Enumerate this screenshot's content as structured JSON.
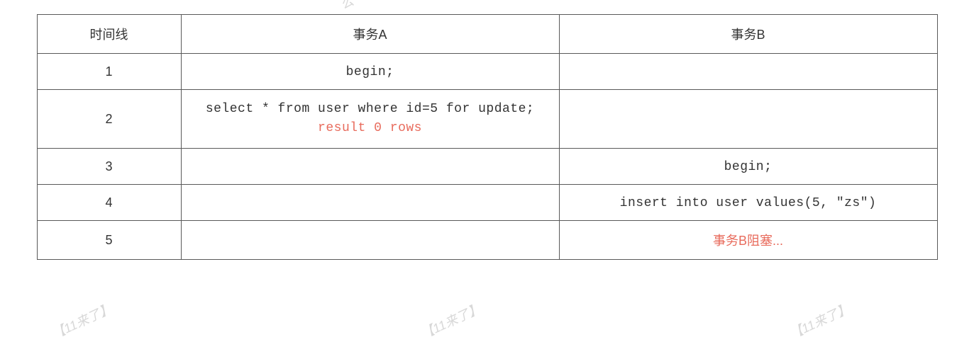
{
  "watermarks": [
    "公",
    "【11来了】",
    "【11来了】",
    "【11来了】"
  ],
  "table": {
    "headers": [
      "时间线",
      "事务A",
      "事务B"
    ],
    "rows": [
      {
        "timeline": "1",
        "txnA": {
          "code": "begin;"
        },
        "txnB": {}
      },
      {
        "timeline": "2",
        "txnA": {
          "code": "select * from user where id=5 for update;",
          "result": "result 0 rows"
        },
        "txnB": {}
      },
      {
        "timeline": "3",
        "txnA": {},
        "txnB": {
          "code": "begin;"
        }
      },
      {
        "timeline": "4",
        "txnA": {},
        "txnB": {
          "code": "insert into user values(5, \"zs\")"
        }
      },
      {
        "timeline": "5",
        "txnA": {},
        "txnB": {
          "block": "事务B阻塞..."
        }
      }
    ]
  }
}
